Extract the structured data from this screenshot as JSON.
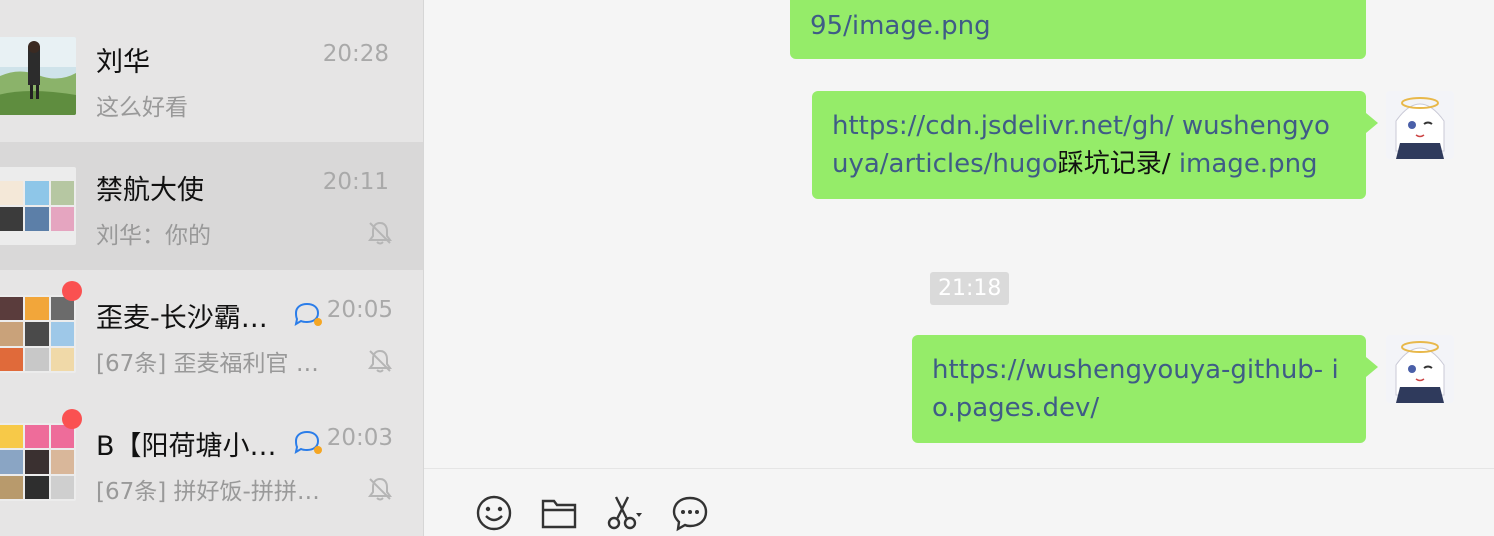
{
  "chats": [
    {
      "name": "刘华",
      "time": "20:28",
      "preview": "这么好看",
      "muted": false,
      "unread": false,
      "mention": false,
      "selected": false
    },
    {
      "name": "禁航大使",
      "time": "20:11",
      "preview": "刘华：你的",
      "muted": true,
      "unread": false,
      "mention": false,
      "selected": true
    },
    {
      "name": "歪麦-长沙霸…",
      "time": "20:05",
      "preview": "[67条] 歪麦福利官 …",
      "muted": true,
      "unread": true,
      "mention": true,
      "selected": false
    },
    {
      "name": "B【阳荷塘小…",
      "time": "20:03",
      "preview": "[67条] 拼好饭-拼拼…",
      "muted": true,
      "unread": true,
      "mention": true,
      "selected": false
    }
  ],
  "messages": [
    {
      "text_link": "95/image.png",
      "text_cn": "",
      "text_link2": ""
    },
    {
      "text_link": "https://cdn.jsdelivr.net/gh/ wushengyouya/articles/hugo",
      "text_cn": "踩坑记录/",
      "text_link2": " image.png"
    },
    {
      "text_link": "https://wushengyouya-github- io.pages.dev/",
      "text_cn": "",
      "text_link2": ""
    }
  ],
  "time_divider": "21:18",
  "toolbar": {
    "icons": [
      "emoji-icon",
      "folder-icon",
      "scissors-icon",
      "chat-bubble-icon"
    ]
  },
  "colors": {
    "bubble": "#95ec69",
    "link": "#3f5c86",
    "unread": "#fa5151",
    "sidebar": "#e6e5e5",
    "selected": "#d9d8d8"
  }
}
